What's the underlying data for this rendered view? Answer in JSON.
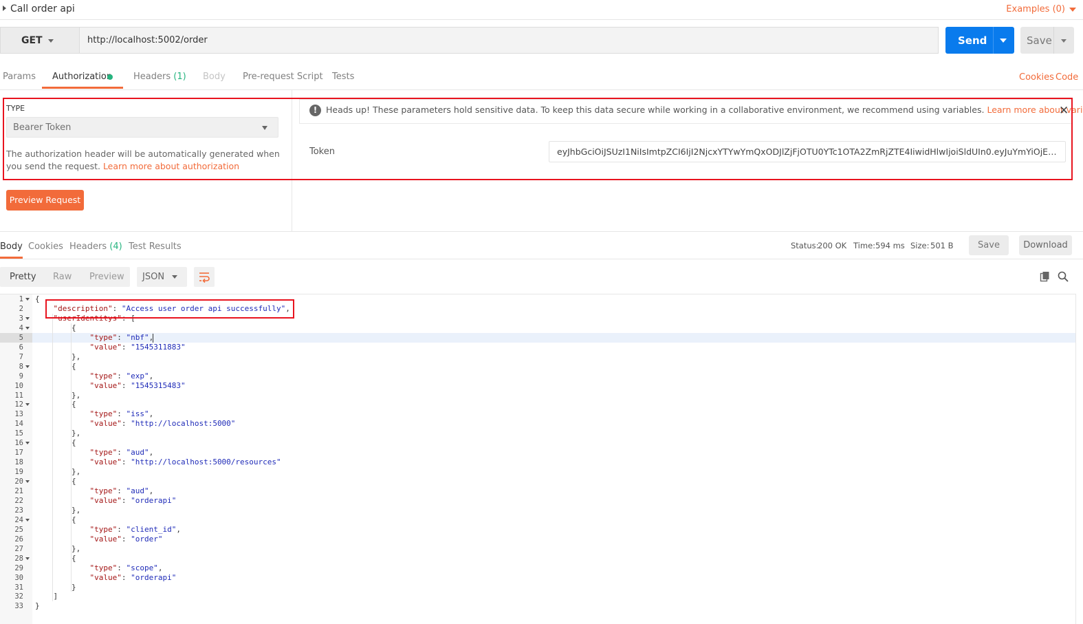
{
  "request": {
    "name": "Call order api",
    "examples_label": "Examples (0)",
    "method": "GET",
    "url": "http://localhost:5002/order",
    "send_label": "Send",
    "save_label": "Save"
  },
  "request_tabs": {
    "params": "Params",
    "authorization": "Authorization",
    "headers": "Headers",
    "headers_count": "(1)",
    "body": "Body",
    "prerequest": "Pre-request Script",
    "tests": "Tests",
    "cookies": "Cookies",
    "code": "Code"
  },
  "auth": {
    "type_label": "TYPE",
    "type_value": "Bearer Token",
    "help_text": "The authorization header will be automatically generated when you send the request.",
    "help_link": "Learn more about authorization",
    "preview_button": "Preview Request",
    "headsup_text": "Heads up! These parameters hold sensitive data. To keep this data secure while working in a collaborative environment, we recommend using variables.",
    "headsup_link": "Learn more about variables",
    "token_label": "Token",
    "token_value": "eyJhbGciOiJSUzI1NiIsImtpZCI6IjI2NjcxYTYwYmQxODJlZjFjOTU0YTc1OTA2ZmRjZTE4IiwidHlwIjoiSldUIn0.eyJuYmYiOjE1NDUzMTE4O..."
  },
  "response_tabs": {
    "body": "Body",
    "cookies": "Cookies",
    "headers": "Headers",
    "headers_count": "(4)",
    "test_results": "Test Results"
  },
  "response_meta": {
    "status_label": "Status:",
    "status_value": "200 OK",
    "time_label": "Time:",
    "time_value": "594 ms",
    "size_label": "Size:",
    "size_value": "501 B",
    "save_label": "Save",
    "download_label": "Download"
  },
  "view": {
    "pretty": "Pretty",
    "raw": "Raw",
    "preview": "Preview",
    "format": "JSON"
  },
  "response_body": {
    "open_brace": "{",
    "description_key": "\"description\"",
    "description_value": "\"Access user order api successfully\"",
    "identities_key": "\"userIdentitys\"",
    "identities": [
      {
        "type": "\"nbf\"",
        "value": "\"1545311883\""
      },
      {
        "type": "\"exp\"",
        "value": "\"1545315483\""
      },
      {
        "type": "\"iss\"",
        "value": "\"http://localhost:5000\""
      },
      {
        "type": "\"aud\"",
        "value": "\"http://localhost:5000/resources\""
      },
      {
        "type": "\"aud\"",
        "value": "\"orderapi\""
      },
      {
        "type": "\"client_id\"",
        "value": "\"order\""
      },
      {
        "type": "\"scope\"",
        "value": "\"orderapi\""
      }
    ],
    "type_key": "\"type\"",
    "value_key": "\"value\"",
    "close_bracket": "]",
    "close_brace": "}"
  }
}
